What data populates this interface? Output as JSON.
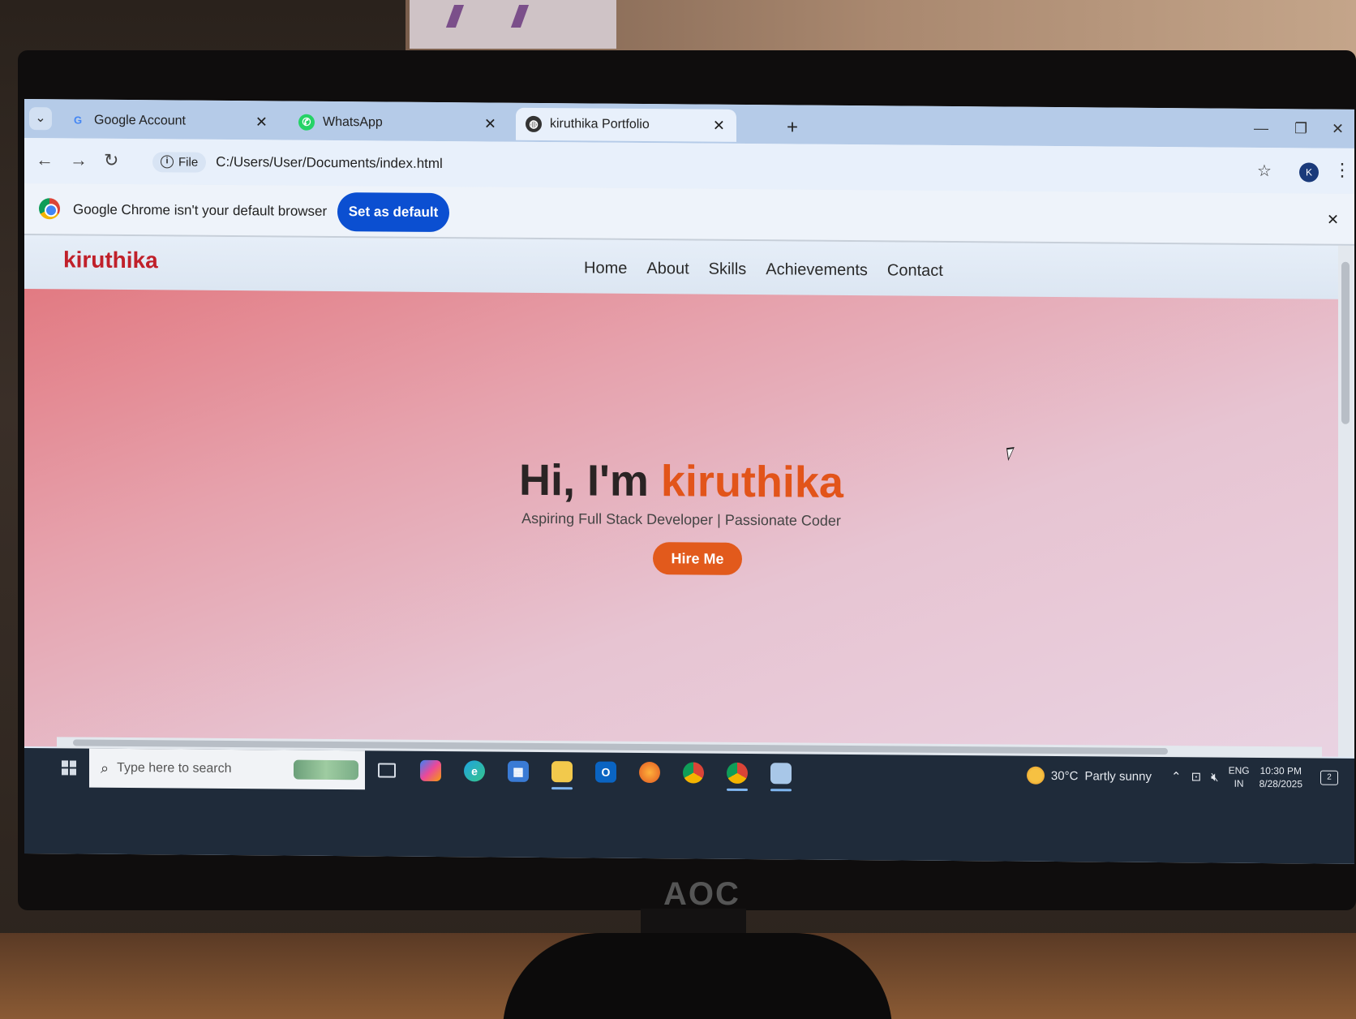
{
  "monitor": {
    "brand": "AOC"
  },
  "browser": {
    "tabs": [
      {
        "title": "Google Account",
        "icon": "google-icon"
      },
      {
        "title": "WhatsApp",
        "icon": "whatsapp-icon"
      },
      {
        "title": "kiruthika Portfolio",
        "icon": "globe-icon",
        "active": true
      }
    ],
    "address": {
      "chip": "File",
      "url": "C:/Users/User/Documents/index.html"
    },
    "profile_initial": "K",
    "infobar": {
      "message": "Google Chrome isn't your default browser",
      "button": "Set as default"
    }
  },
  "site": {
    "logo": "kiruthika",
    "nav": [
      "Home",
      "About",
      "Skills",
      "Achievements",
      "Contact"
    ],
    "hero": {
      "greeting": "Hi, I'm ",
      "name": "kiruthika",
      "subtitle": "Aspiring Full Stack Developer | Passionate Coder",
      "cta": "Hire Me"
    }
  },
  "taskbar": {
    "search_placeholder": "Type here to search",
    "weather": {
      "temp": "30°C",
      "condition": "Partly sunny"
    },
    "language": {
      "line1": "ENG",
      "line2": "IN"
    },
    "clock": {
      "time": "10:30 PM",
      "date": "8/28/2025"
    },
    "notifications": "2"
  },
  "colors": {
    "accent": "#e2541a",
    "logo": "#c0202a",
    "infobar_button": "#0b4fd1"
  }
}
